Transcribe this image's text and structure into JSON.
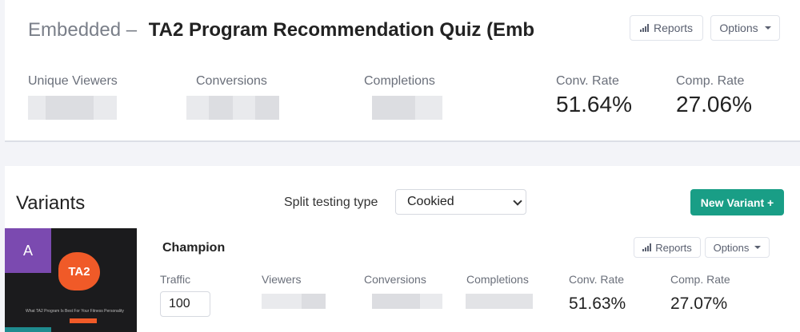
{
  "header": {
    "prefix": "Embedded –",
    "title": "TA2 Program Recommendation Quiz (Emb",
    "reports_label": "Reports",
    "options_label": "Options"
  },
  "stats": {
    "unique_viewers_label": "Unique Viewers",
    "conversions_label": "Conversions",
    "completions_label": "Completions",
    "conv_rate_label": "Conv. Rate",
    "conv_rate_value": "51.64%",
    "comp_rate_label": "Comp. Rate",
    "comp_rate_value": "27.06%"
  },
  "variants": {
    "title": "Variants",
    "split_label": "Split testing type",
    "split_value": "Cookied",
    "new_variant_label": "New Variant +"
  },
  "variant_a": {
    "badge": "A",
    "logo_text": "TA2",
    "caption": "What TA2 Program Is Best For Your Fitness Personality",
    "name": "Champion",
    "reports_label": "Reports",
    "options_label": "Options",
    "traffic_label": "Traffic",
    "traffic_value": "100",
    "viewers_label": "Viewers",
    "conversions_label": "Conversions",
    "completions_label": "Completions",
    "conv_rate_label": "Conv. Rate",
    "conv_rate_value": "51.63%",
    "comp_rate_label": "Comp. Rate",
    "comp_rate_value": "27.07%"
  },
  "colors": {
    "accent": "#199e86",
    "badge_a": "#7b4ab0",
    "logo": "#f05a28"
  }
}
